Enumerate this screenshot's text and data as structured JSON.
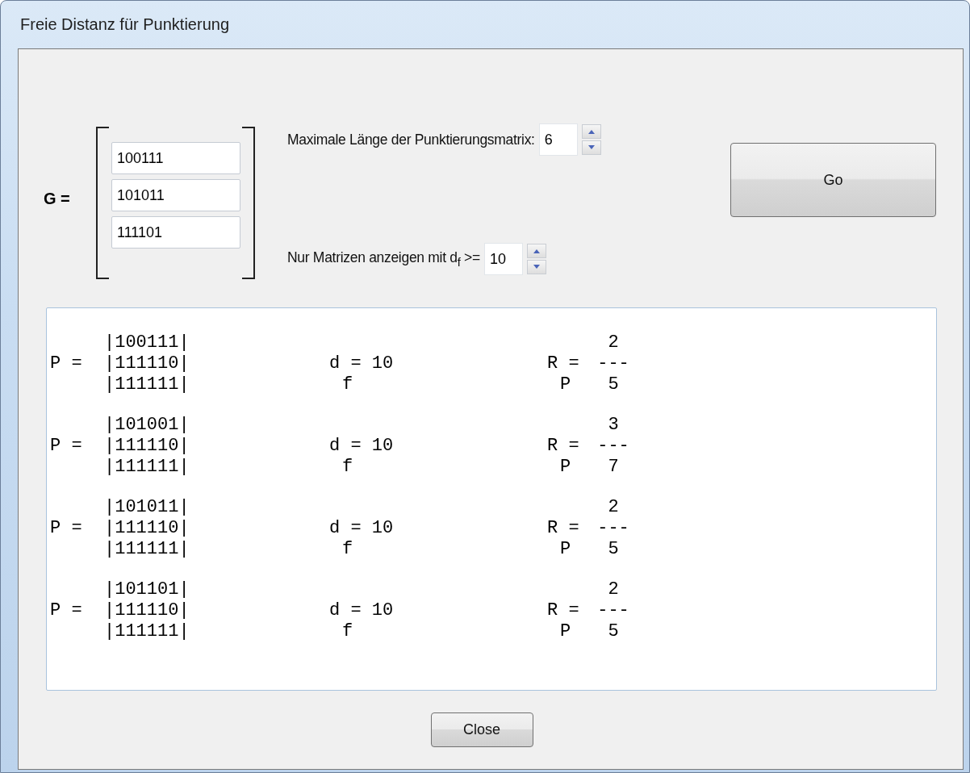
{
  "window": {
    "title": "Freie Distanz für Punktierung"
  },
  "generator": {
    "label": "G =",
    "rows": [
      "100111",
      "101011",
      "111101"
    ]
  },
  "spinners": [
    {
      "label": "Maximale Länge der Punktierungsmatrix:",
      "value": "6"
    },
    {
      "label": "Nur Matrizen anzeigen mit d$_{f}$ >=",
      "value": "10"
    }
  ],
  "go_button": "Go",
  "results": [
    {
      "p_label": "P =",
      "rows": [
        "|100111|",
        "|111110|",
        "|111111|"
      ],
      "df": "d = 10",
      "df_sub": "f",
      "rate_label": "R =",
      "rate_sub": "P",
      "numerator": "2",
      "bar": "---",
      "denominator": "5"
    },
    {
      "p_label": "P =",
      "rows": [
        "|101001|",
        "|111110|",
        "|111111|"
      ],
      "df": "d = 10",
      "df_sub": "f",
      "rate_label": "R =",
      "rate_sub": "P",
      "numerator": "3",
      "bar": "---",
      "denominator": "7"
    },
    {
      "p_label": "P =",
      "rows": [
        "|101011|",
        "|111110|",
        "|111111|"
      ],
      "df": "d = 10",
      "df_sub": "f",
      "rate_label": "R =",
      "rate_sub": "P",
      "numerator": "2",
      "bar": "---",
      "denominator": "5"
    },
    {
      "p_label": "P =",
      "rows": [
        "|101101|",
        "|111110|",
        "|111111|"
      ],
      "df": "d = 10",
      "df_sub": "f",
      "rate_label": "R =",
      "rate_sub": "P",
      "numerator": "2",
      "bar": "---",
      "denominator": "5"
    }
  ],
  "close_button": "Close"
}
